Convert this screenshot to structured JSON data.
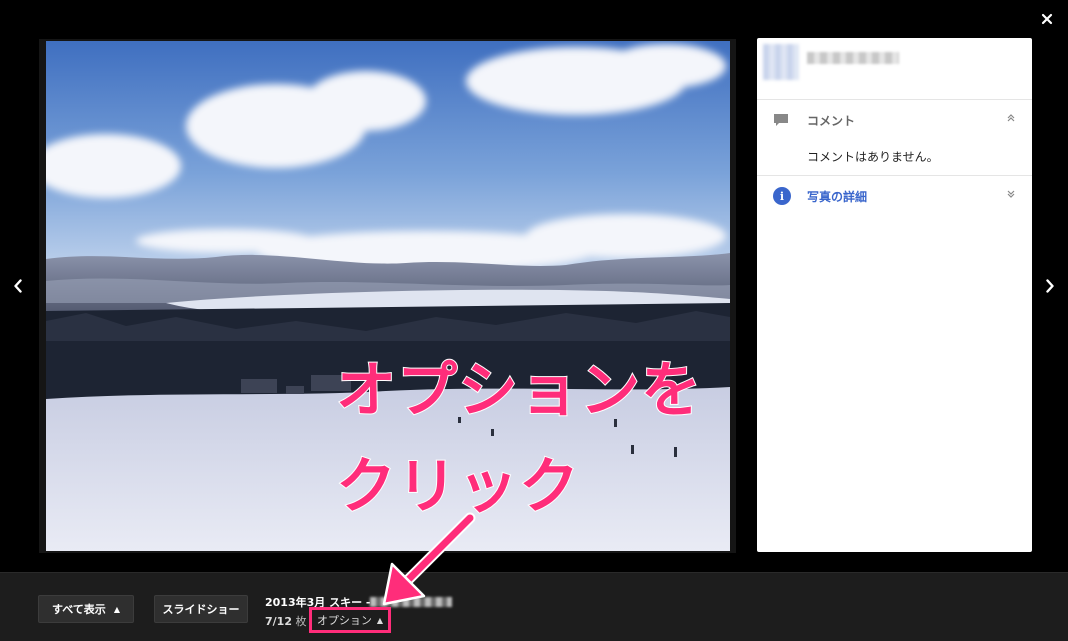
{
  "viewer": {
    "close_icon": "close-icon",
    "prev_icon": "chevron-left-icon",
    "next_icon": "chevron-right-icon"
  },
  "annotation": {
    "line1": "オプションを",
    "line2": "クリック",
    "color": "#ff2d7a"
  },
  "side_panel": {
    "comments": {
      "title": "コメント",
      "empty_text": "コメントはありません。",
      "expand_icon": "chevron-up-icon"
    },
    "details": {
      "title": "写真の詳細",
      "expand_icon": "chevron-down-icon",
      "accent": "#3a66cc"
    }
  },
  "bottom_bar": {
    "show_all_label": "すべて表示",
    "show_all_caret": "▲",
    "slideshow_label": "スライドショー",
    "album_title": "2013年3月 スキー -",
    "count_position": "7/12",
    "count_unit": "枚",
    "options_label": "オプション",
    "options_caret": "▲"
  }
}
